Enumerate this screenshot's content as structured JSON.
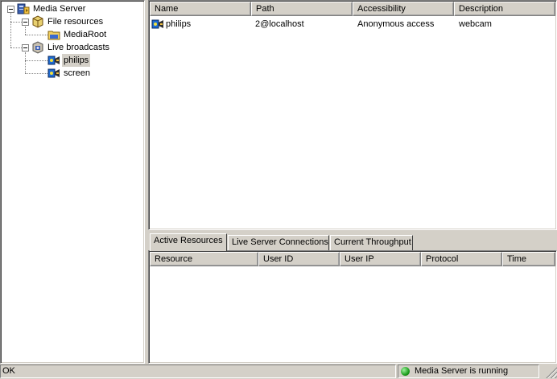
{
  "tree": {
    "root": {
      "label": "Media Server",
      "icon": "media-server-icon"
    },
    "file_resources": {
      "label": "File resources",
      "icon": "folder-resource-icon"
    },
    "media_root": {
      "label": "MediaRoot",
      "icon": "folder-icon"
    },
    "live_broadcasts": {
      "label": "Live broadcasts",
      "icon": "broadcast-group-icon"
    },
    "philips": {
      "label": "philips",
      "icon": "webcam-stream-icon"
    },
    "screen": {
      "label": "screen",
      "icon": "webcam-stream-icon"
    }
  },
  "resources_list": {
    "columns": [
      "Name",
      "Path",
      "Accessibility",
      "Description"
    ],
    "rows": [
      {
        "name": "philips",
        "path": "2@localhost",
        "accessibility": "Anonymous access",
        "description": "webcam"
      }
    ]
  },
  "tabs": [
    {
      "label": "Active Resources",
      "active": true
    },
    {
      "label": "Live Server Connections",
      "active": false
    },
    {
      "label": "Current Throughput",
      "active": false
    }
  ],
  "connections_list": {
    "columns": [
      "Resource",
      "User ID",
      "User IP",
      "Protocol",
      "Time"
    ],
    "rows": []
  },
  "status": {
    "left_text": "OK",
    "server_text": "Media Server is running",
    "server_indicator_color": "#1e9e1e"
  }
}
